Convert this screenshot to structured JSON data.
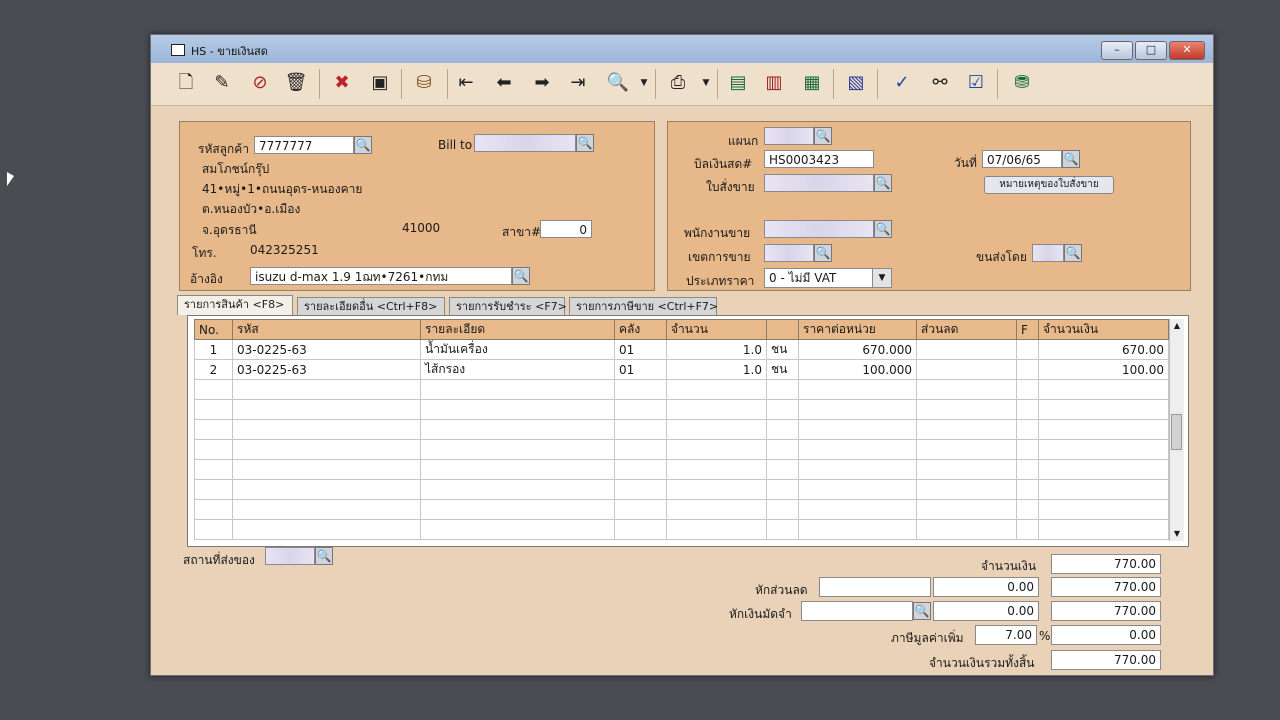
{
  "window": {
    "title": "HS - ขายเงินสด",
    "minimize": "–",
    "maximize": "□",
    "close": "✕"
  },
  "toolbar": {
    "icons": [
      "new-icon",
      "edit-icon",
      "delete-record-icon",
      "trash-icon",
      "cancel-icon",
      "save-icon",
      "attach-icon",
      "first-icon",
      "prev-icon",
      "next-icon",
      "last-icon",
      "find-icon",
      "print-icon",
      "report-icon",
      "calc-icon",
      "export-icon",
      "import-icon",
      "approve-icon",
      "link-icon",
      "ok-icon",
      "database-icon"
    ]
  },
  "customer": {
    "code_label": "รหัสลูกค้า",
    "code": "7777777",
    "bill_to_label": "Bill to",
    "bill_to": "",
    "name": "สมโภชน์กรุ๊ป",
    "address1": "41•หมู่•1•ถนนอุดร-หนองคาย",
    "address2": "ต.หนองบัว•อ.เมือง",
    "address3": "จ.อุดรธานี",
    "postcode": "41000",
    "branch_label": "สาขา#",
    "branch": "0",
    "phone_label": "โทร.",
    "phone": "042325251",
    "reference_label": "อ้างอิง",
    "reference": "isuzu d-max 1.9 1ฌท•7261•กทม"
  },
  "document": {
    "department_label": "แผนก",
    "department": "",
    "bill_label": "บิลเงินสด#",
    "bill_no": "HS0003423",
    "date_label": "วันที่",
    "date": "07/06/65",
    "sales_order_label": "ใบสั่งขาย",
    "sales_order": "",
    "note_button": "หมายเหตุของใบสั่งขาย",
    "salesperson_label": "พนักงานขาย",
    "salesperson": "",
    "sales_area_label": "เขตการขาย",
    "sales_area": "",
    "ship_by_label": "ขนส่งโดย",
    "ship_by": "",
    "price_type_label": "ประเภทราคา",
    "price_type": "0 - ไม่มี VAT"
  },
  "tabs": [
    {
      "label": "รายการสินค้า <F8>"
    },
    {
      "label": "รายละเอียดอื่น <Ctrl+F8>"
    },
    {
      "label": "รายการรับชำระ <F7>"
    },
    {
      "label": "รายการภาษีขาย <Ctrl+F7>"
    }
  ],
  "grid": {
    "headers": [
      "No.",
      "รหัส",
      "รายละเอียด",
      "คลัง",
      "จำนวน",
      "",
      "ราคาต่อหน่วย",
      "ส่วนลด",
      "F",
      "จำนวนเงิน"
    ],
    "rows": [
      {
        "no": "1",
        "code": "03-0225-63",
        "desc": "น้ำมันเครื่อง",
        "wh": "01",
        "qty": "1.0",
        "unit": "ชน",
        "price": "670.000",
        "disc": "",
        "f": "",
        "amount": "670.00"
      },
      {
        "no": "2",
        "code": "03-0225-63",
        "desc": "ไส้กรอง",
        "wh": "01",
        "qty": "1.0",
        "unit": "ชน",
        "price": "100.000",
        "disc": "",
        "f": "",
        "amount": "100.00"
      }
    ]
  },
  "footer": {
    "ship_place_label": "สถานที่ส่งของ",
    "ship_place": "",
    "amount_label": "จำนวนเงิน",
    "amount": "770.00",
    "discount_label": "หักส่วนลด",
    "discount_text": "",
    "discount": "0.00",
    "after_discount": "770.00",
    "deposit_label": "หักเงินมัดจำ",
    "deposit_ref": "",
    "deposit": "0.00",
    "after_deposit": "770.00",
    "vat_label": "ภาษีมูลค่าเพิ่ม",
    "vat_rate": "7.00",
    "vat_percent": "%",
    "vat": "0.00",
    "total_label": "จำนวนเงินรวมทั้งสิ้น",
    "total": "770.00"
  }
}
